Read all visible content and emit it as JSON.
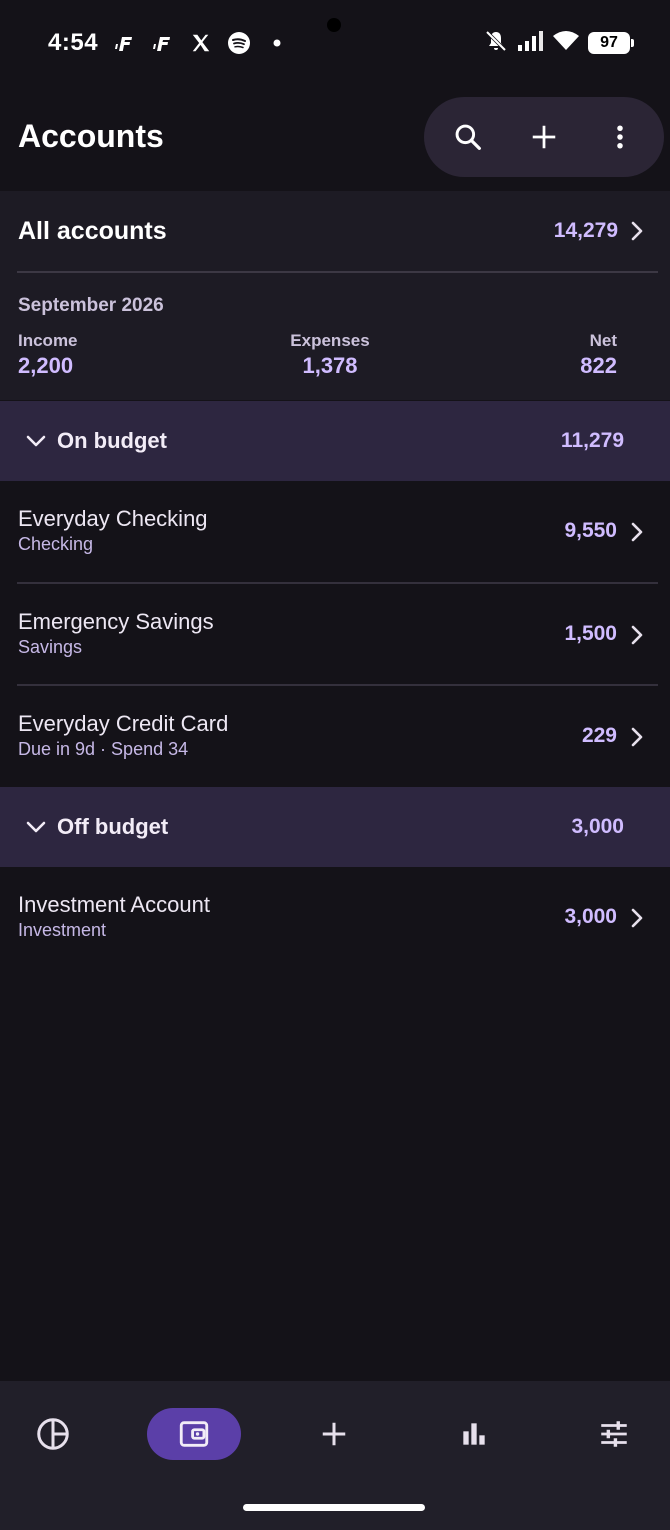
{
  "status_bar": {
    "time": "4:54",
    "battery": "97",
    "left_icons": [
      "notification-icon",
      "notification-icon",
      "x-icon",
      "spotify-icon",
      "dot-icon"
    ],
    "right_icons": [
      "bell-off-icon",
      "signal-icon",
      "wifi-icon",
      "battery-icon"
    ]
  },
  "header": {
    "title": "Accounts",
    "actions": [
      "search-icon",
      "add-icon",
      "more-vert-icon"
    ]
  },
  "summary": {
    "all_accounts_label": "All accounts",
    "all_accounts_value": "14,279",
    "month": "September 2026",
    "income_label": "Income",
    "income_value": "2,200",
    "expenses_label": "Expenses",
    "expenses_value": "1,378",
    "net_label": "Net",
    "net_value": "822"
  },
  "groups": [
    {
      "label": "On budget",
      "value": "11,279",
      "accounts": [
        {
          "name": "Everyday Checking",
          "sub": "Checking",
          "value": "9,550"
        },
        {
          "name": "Emergency Savings",
          "sub": "Savings",
          "value": "1,500"
        },
        {
          "name": "Everyday Credit Card",
          "sub": "Due in 9d · Spend 34",
          "value": "229"
        }
      ]
    },
    {
      "label": "Off budget",
      "value": "3,000",
      "accounts": [
        {
          "name": "Investment Account",
          "sub": "Investment",
          "value": "3,000"
        }
      ]
    }
  ],
  "bottom_nav": {
    "items": [
      "budget-pie-icon",
      "wallet-icon",
      "add-icon",
      "bar-chart-icon",
      "tune-icon"
    ],
    "active": "wallet-icon"
  },
  "colors": {
    "background": "#141218",
    "accent": "#d0bcff",
    "group_header": "#2d2640",
    "active_nav": "#5b3fa8"
  }
}
